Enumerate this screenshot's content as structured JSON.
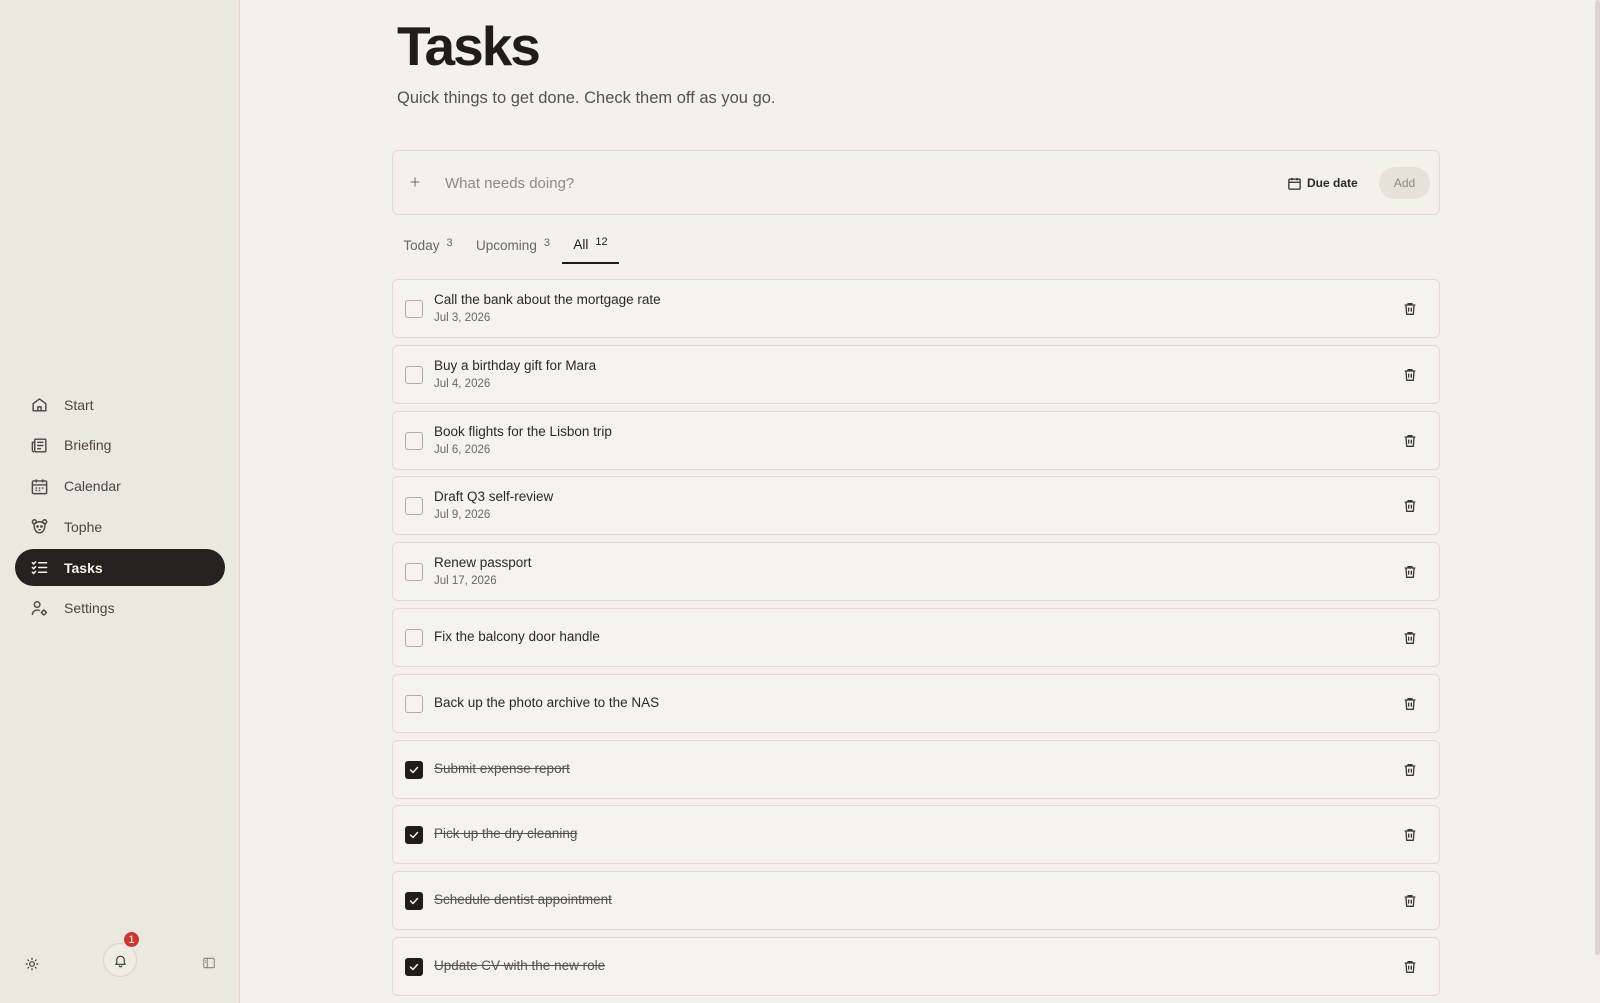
{
  "sidebar": {
    "items": [
      {
        "label": "Start",
        "icon": "home-icon",
        "active": false
      },
      {
        "label": "Briefing",
        "icon": "newspaper-icon",
        "active": false
      },
      {
        "label": "Calendar",
        "icon": "calendar-icon",
        "active": false
      },
      {
        "label": "Tophe",
        "icon": "bear-face-icon",
        "active": false
      },
      {
        "label": "Tasks",
        "icon": "task-list-icon",
        "active": true
      },
      {
        "label": "Settings",
        "icon": "user-gear-icon",
        "active": false
      }
    ],
    "footer": {
      "notification_count": "1"
    }
  },
  "page": {
    "title": "Tasks",
    "subtitle": "Quick things to get done. Check them off as you go."
  },
  "add_bar": {
    "placeholder": "What needs doing?",
    "due_date_label": "Due date",
    "add_label": "Add"
  },
  "tabs": [
    {
      "label": "Today",
      "count": "3",
      "active": false
    },
    {
      "label": "Upcoming",
      "count": "3",
      "active": false
    },
    {
      "label": "All",
      "count": "12",
      "active": true
    }
  ],
  "tasks": [
    {
      "title": "Call the bank about the mortgage rate",
      "date": "Jul 3, 2026",
      "done": false
    },
    {
      "title": "Buy a birthday gift for Mara",
      "date": "Jul 4, 2026",
      "done": false
    },
    {
      "title": "Book flights for the Lisbon trip",
      "date": "Jul 6, 2026",
      "done": false
    },
    {
      "title": "Draft Q3 self-review",
      "date": "Jul 9, 2026",
      "done": false
    },
    {
      "title": "Renew passport",
      "date": "Jul 17, 2026",
      "done": false
    },
    {
      "title": "Fix the balcony door handle",
      "date": "",
      "done": false
    },
    {
      "title": "Back up the photo archive to the NAS",
      "date": "",
      "done": false
    },
    {
      "title": "Submit expense report",
      "date": "",
      "done": true
    },
    {
      "title": "Pick up the dry cleaning",
      "date": "",
      "done": true
    },
    {
      "title": "Schedule dentist appointment",
      "date": "",
      "done": true
    },
    {
      "title": "Update CV with the new role",
      "date": "",
      "done": true
    }
  ]
}
